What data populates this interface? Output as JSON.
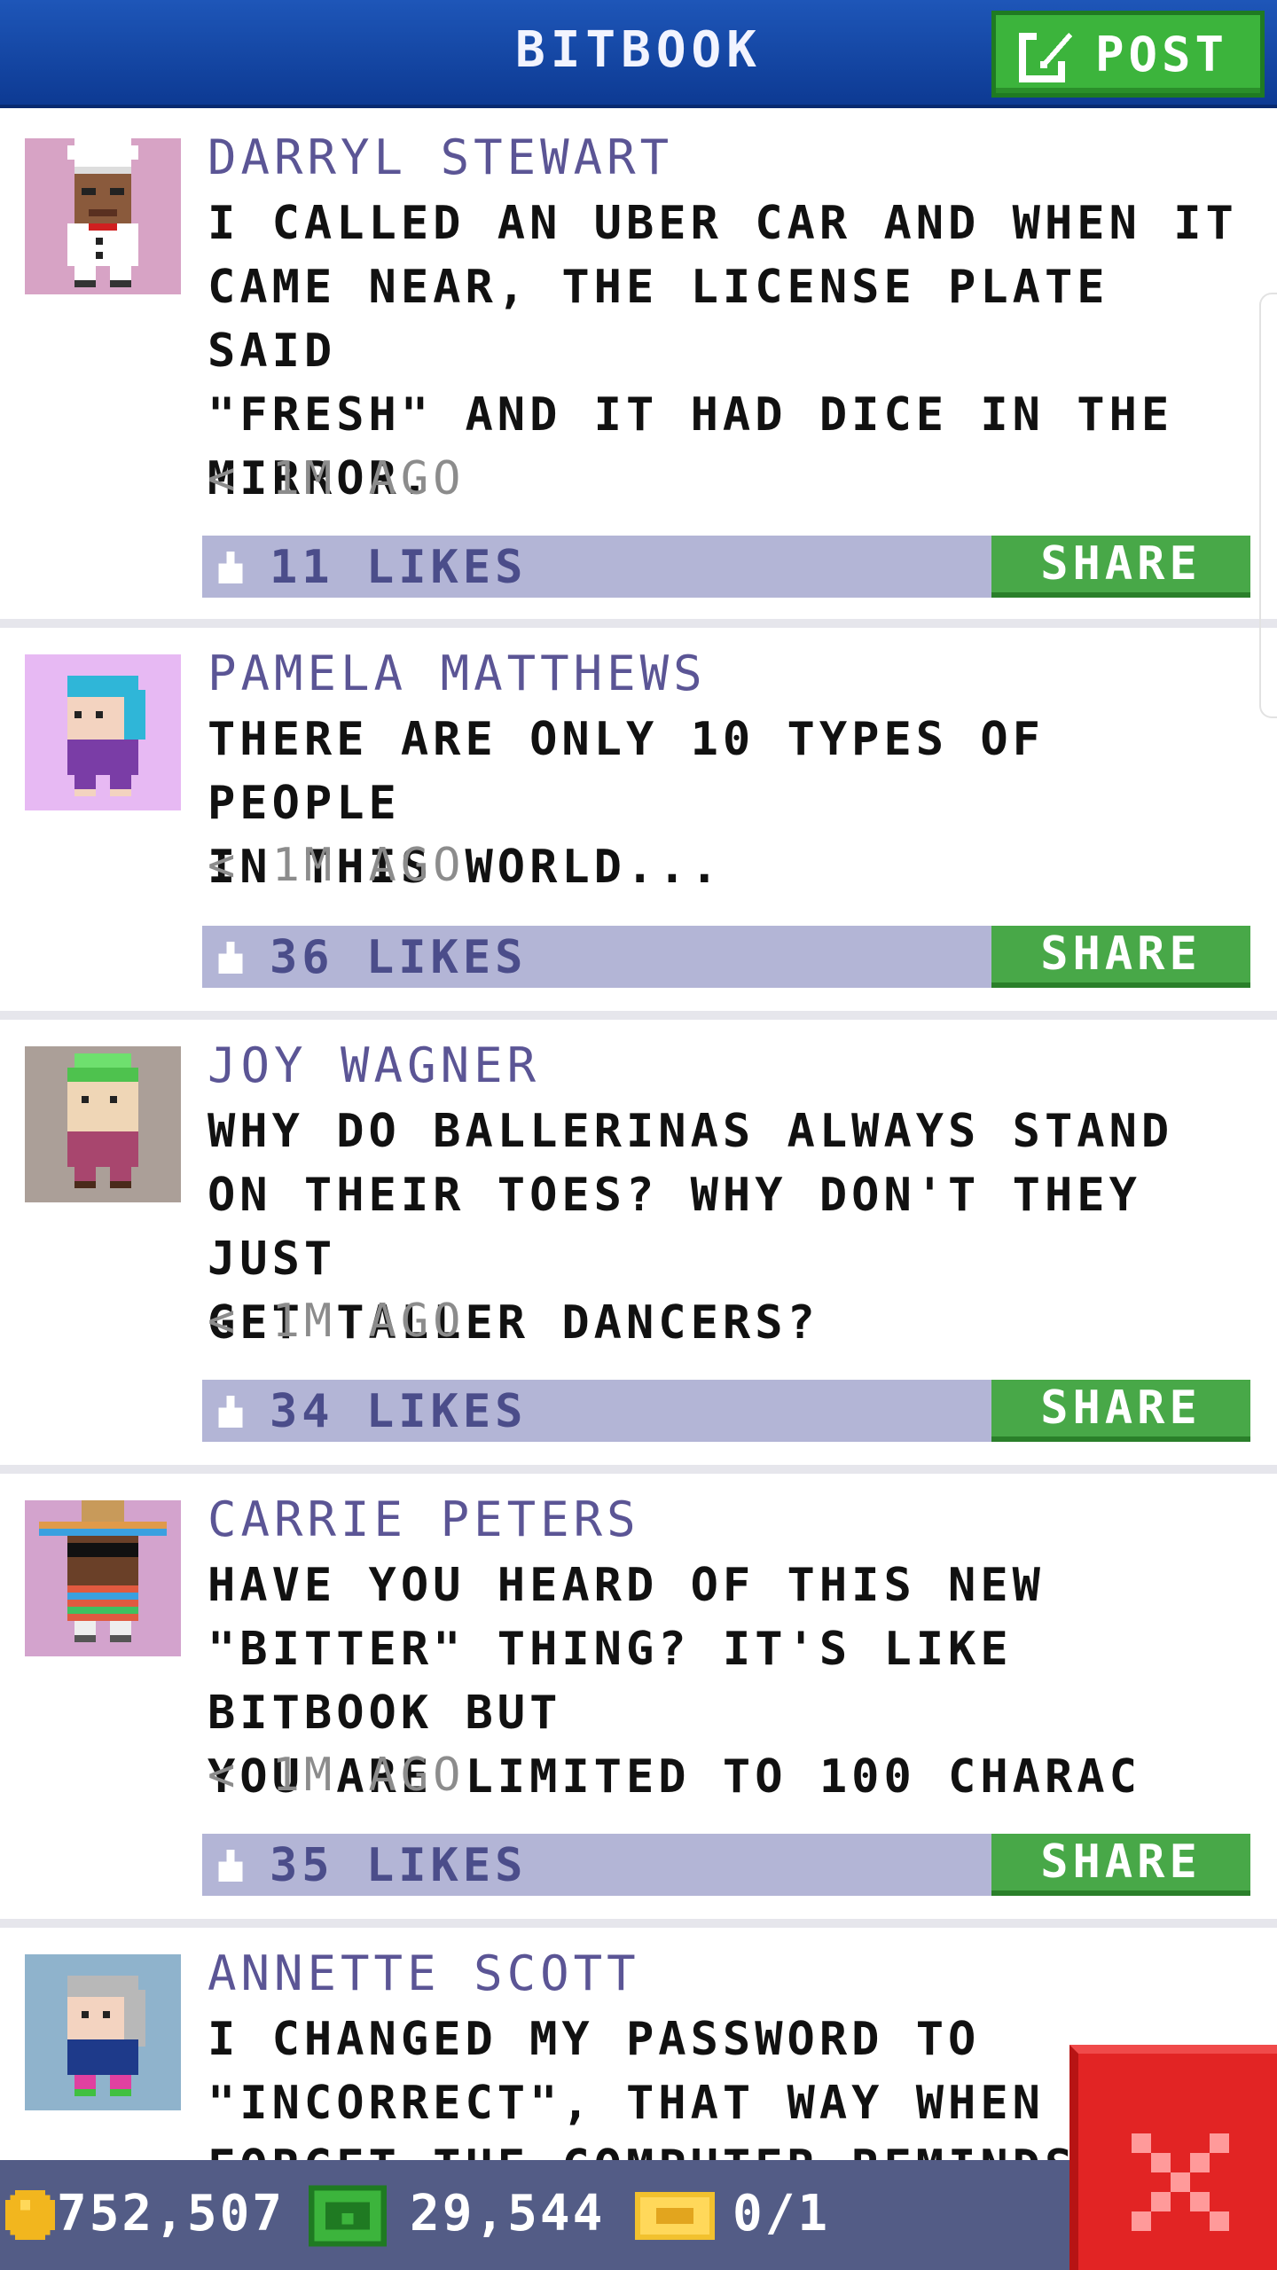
{
  "header": {
    "title": "BITBOOK",
    "post_label": "POST"
  },
  "posts": [
    {
      "author": "DARRYL STEWART",
      "text": "I CALLED AN UBER CAR AND WHEN IT\nCAME NEAR, THE LICENSE PLATE SAID\n\"FRESH\" AND IT HAD DICE IN THE\nMIRROR.",
      "time": "< 1M AGO",
      "likes": "11 LIKES",
      "share": "SHARE",
      "avatar_bg": "#d7a3c5",
      "avatar": "chef-avatar-icon"
    },
    {
      "author": "PAMELA MATTHEWS",
      "text": "THERE ARE ONLY 10 TYPES OF PEOPLE\nIN THIS WORLD...",
      "time": "< 1M AGO",
      "likes": "36 LIKES",
      "share": "SHARE",
      "avatar_bg": "#e7b9f3",
      "avatar": "blue-hair-avatar-icon"
    },
    {
      "author": "JOY WAGNER",
      "text": "WHY DO BALLERINAS ALWAYS STAND\nON THEIR TOES? WHY DON'T THEY JUST\nGET TALLER DANCERS?",
      "time": "< 1M AGO",
      "likes": "34 LIKES",
      "share": "SHARE",
      "avatar_bg": "#ab9f98",
      "avatar": "green-hat-avatar-icon"
    },
    {
      "author": "CARRIE PETERS",
      "text": "HAVE YOU HEARD OF THIS NEW\n\"BITTER\" THING? IT'S LIKE BITBOOK BUT\nYOU ARE LIMITED TO 100 CHARAC",
      "time": "< 1M AGO",
      "likes": "35 LIKES",
      "share": "SHARE",
      "avatar_bg": "#d3a3cd",
      "avatar": "sombrero-avatar-icon"
    },
    {
      "author": "ANNETTE SCOTT",
      "text": "I CHANGED MY PASSWORD TO\n\"INCORRECT\", THAT WAY WHEN I\nFORGET THE COMPUTER REMINDS",
      "time": "",
      "likes": "",
      "share": "",
      "avatar_bg": "#8fb3cc",
      "avatar": "gray-hair-avatar-icon"
    }
  ],
  "bottom_bar": {
    "coins": "752,507",
    "bux": "29,544",
    "tickets": "0/1"
  },
  "colors": {
    "accent_blue": "#0d3a93",
    "green": "#48a848",
    "likes_bar": "#b3b5d6",
    "close_red": "#e22424"
  }
}
